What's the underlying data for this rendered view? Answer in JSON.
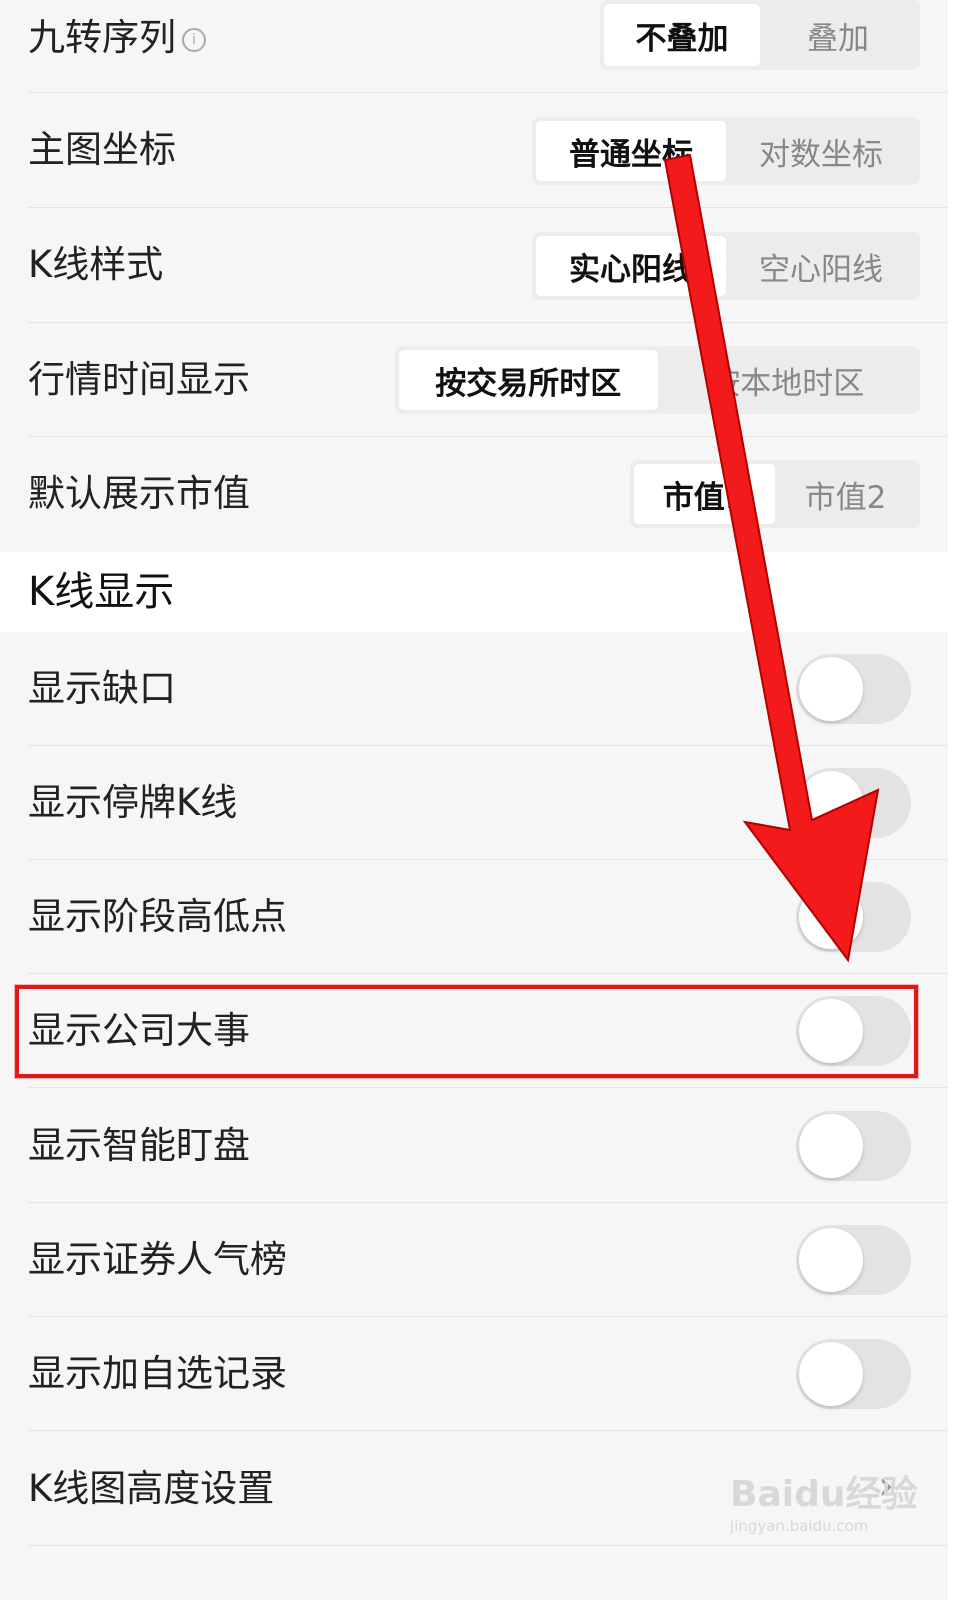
{
  "rows": {
    "overlay_sequence": {
      "label": "九转序列",
      "options": [
        "不叠加",
        "叠加"
      ]
    },
    "main_axis": {
      "label": "主图坐标",
      "options": [
        "普通坐标",
        "对数坐标"
      ]
    },
    "kline_style": {
      "label": "K线样式",
      "options": [
        "实心阳线",
        "空心阳线"
      ]
    },
    "quote_time": {
      "label": "行情时间显示",
      "options": [
        "按交易所时区",
        "按本地时区"
      ]
    },
    "market_cap": {
      "label": "默认展示市值",
      "options": [
        "市值1",
        "市值2"
      ]
    }
  },
  "section_title": "K线显示",
  "toggles": [
    {
      "label": "显示缺口",
      "on": false
    },
    {
      "label": "显示停牌K线",
      "on": false
    },
    {
      "label": "显示阶段高低点",
      "on": false
    },
    {
      "label": "显示公司大事",
      "on": false
    },
    {
      "label": "显示智能盯盘",
      "on": false
    },
    {
      "label": "显示证券人气榜",
      "on": false
    },
    {
      "label": "显示加自选记录",
      "on": false
    }
  ],
  "kline_height": {
    "label": "K线图高度设置"
  },
  "icons": {
    "info": "i",
    "chevron": "›"
  },
  "watermark": {
    "brand": "Baidu经验",
    "url": "jingyan.baidu.com"
  },
  "colors": {
    "annotation": "#e01818",
    "toggle_off": "#e3e3e3"
  }
}
